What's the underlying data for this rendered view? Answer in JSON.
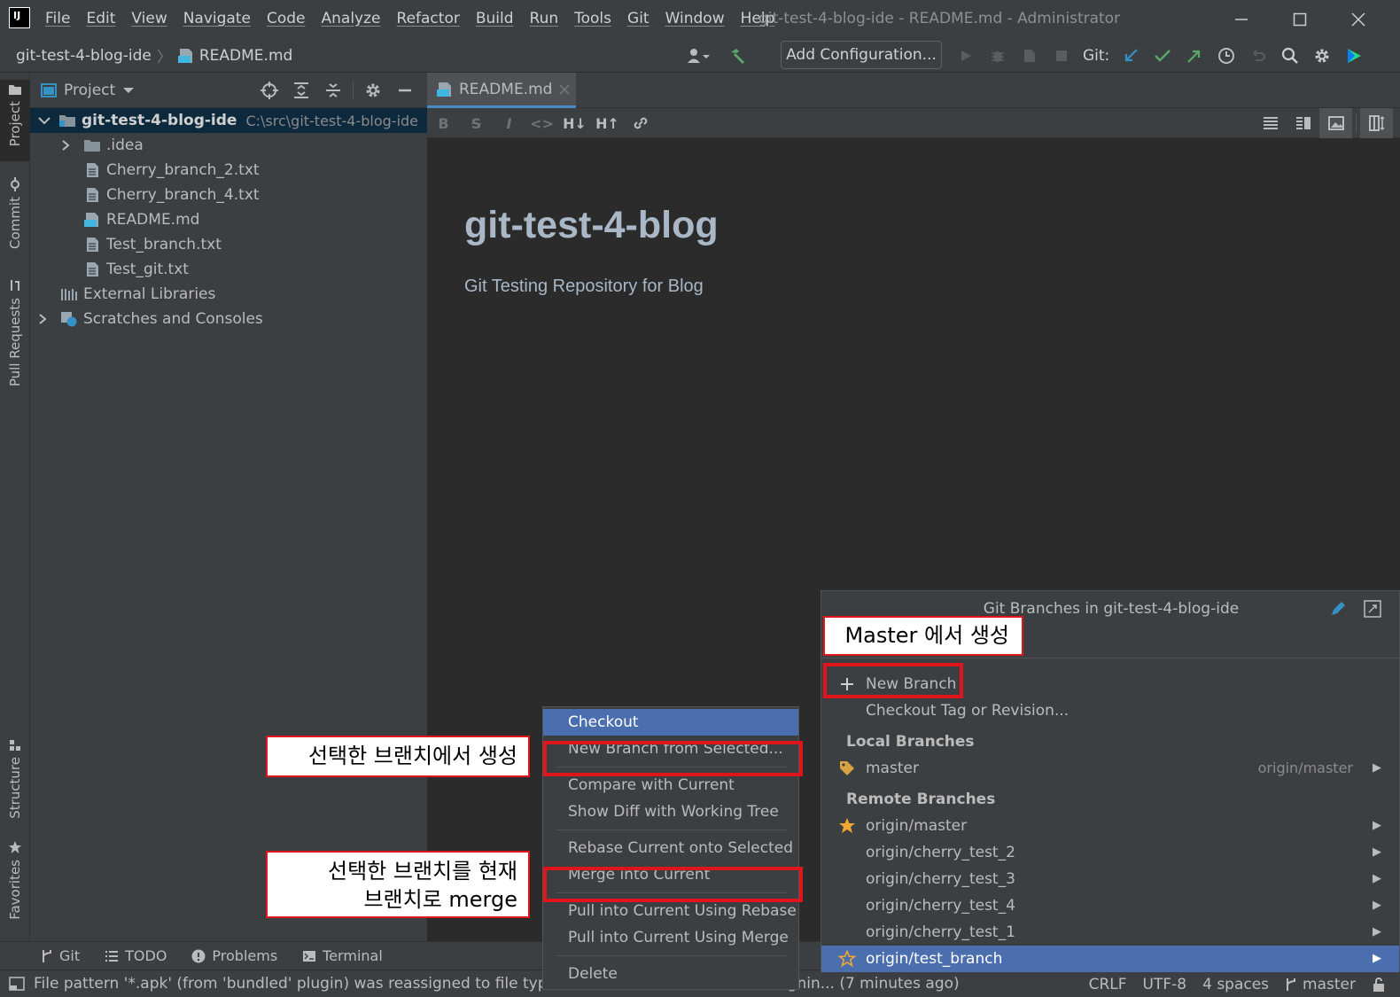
{
  "app": {
    "logo_text": "IJ",
    "menu": [
      "File",
      "Edit",
      "View",
      "Navigate",
      "Code",
      "Analyze",
      "Refactor",
      "Build",
      "Run",
      "Tools",
      "Git",
      "Window",
      "Help"
    ],
    "window_title": "git-test-4-blog-ide - README.md - Administrator"
  },
  "navbar": {
    "breadcrumb_project": "git-test-4-blog-ide",
    "breadcrumb_file": "README.md",
    "add_configuration": "Add Configuration...",
    "git_label": "Git:"
  },
  "left_stripe": {
    "tabs": [
      "Project",
      "Commit",
      "Pull Requests",
      "Structure",
      "Favorites"
    ]
  },
  "project_panel": {
    "title": "Project",
    "tree": [
      {
        "label": "git-test-4-blog-ide",
        "path": "C:\\src\\git-test-4-blog-ide"
      },
      {
        "label": ".idea"
      },
      {
        "label": "Cherry_branch_2.txt"
      },
      {
        "label": "Cherry_branch_4.txt"
      },
      {
        "label": "README.md"
      },
      {
        "label": "Test_branch.txt"
      },
      {
        "label": "Test_git.txt"
      },
      {
        "label": "External Libraries"
      },
      {
        "label": "Scratches and Consoles"
      }
    ]
  },
  "editor": {
    "tab_label": "README.md",
    "md_toolbar": [
      "B",
      "S",
      "I",
      "<>",
      "H↓",
      "H↑"
    ],
    "preview_h1": "git-test-4-blog",
    "preview_p": "Git Testing Repository for Blog"
  },
  "bottom_tabs": [
    "Git",
    "TODO",
    "Problems",
    "Terminal"
  ],
  "status": {
    "message": "File pattern '*.apk' (from 'bundled' plugin) was reassigned to file type 'APK': Confirm or revert reassignin... (7 minutes ago)",
    "line_sep": "CRLF",
    "encoding": "UTF-8",
    "indent": "4 spaces",
    "branch": "master"
  },
  "branches_popup": {
    "title": "Git Branches in git-test-4-blog-ide",
    "new_branch": "New Branch",
    "checkout_tag": "Checkout Tag or Revision...",
    "local_header": "Local Branches",
    "local": [
      {
        "name": "master",
        "tracking": "origin/master"
      }
    ],
    "remote_header": "Remote Branches",
    "remote": [
      "origin/master",
      "origin/cherry_test_2",
      "origin/cherry_test_3",
      "origin/cherry_test_4",
      "origin/cherry_test_1",
      "origin/test_branch"
    ]
  },
  "context_menu": {
    "items": [
      "Checkout",
      "New Branch from Selected...",
      "Compare with Current",
      "Show Diff with Working Tree",
      "Rebase Current onto Selected",
      "Merge into Current",
      "Pull into Current Using Rebase",
      "Pull into Current Using Merge",
      "Delete"
    ]
  },
  "annotations": {
    "master_create": "Master 에서 생성",
    "from_selected": "선택한 브랜치에서 생성",
    "merge_line1": "선택한 브랜치를 현재",
    "merge_line2": "브랜치로 merge"
  }
}
